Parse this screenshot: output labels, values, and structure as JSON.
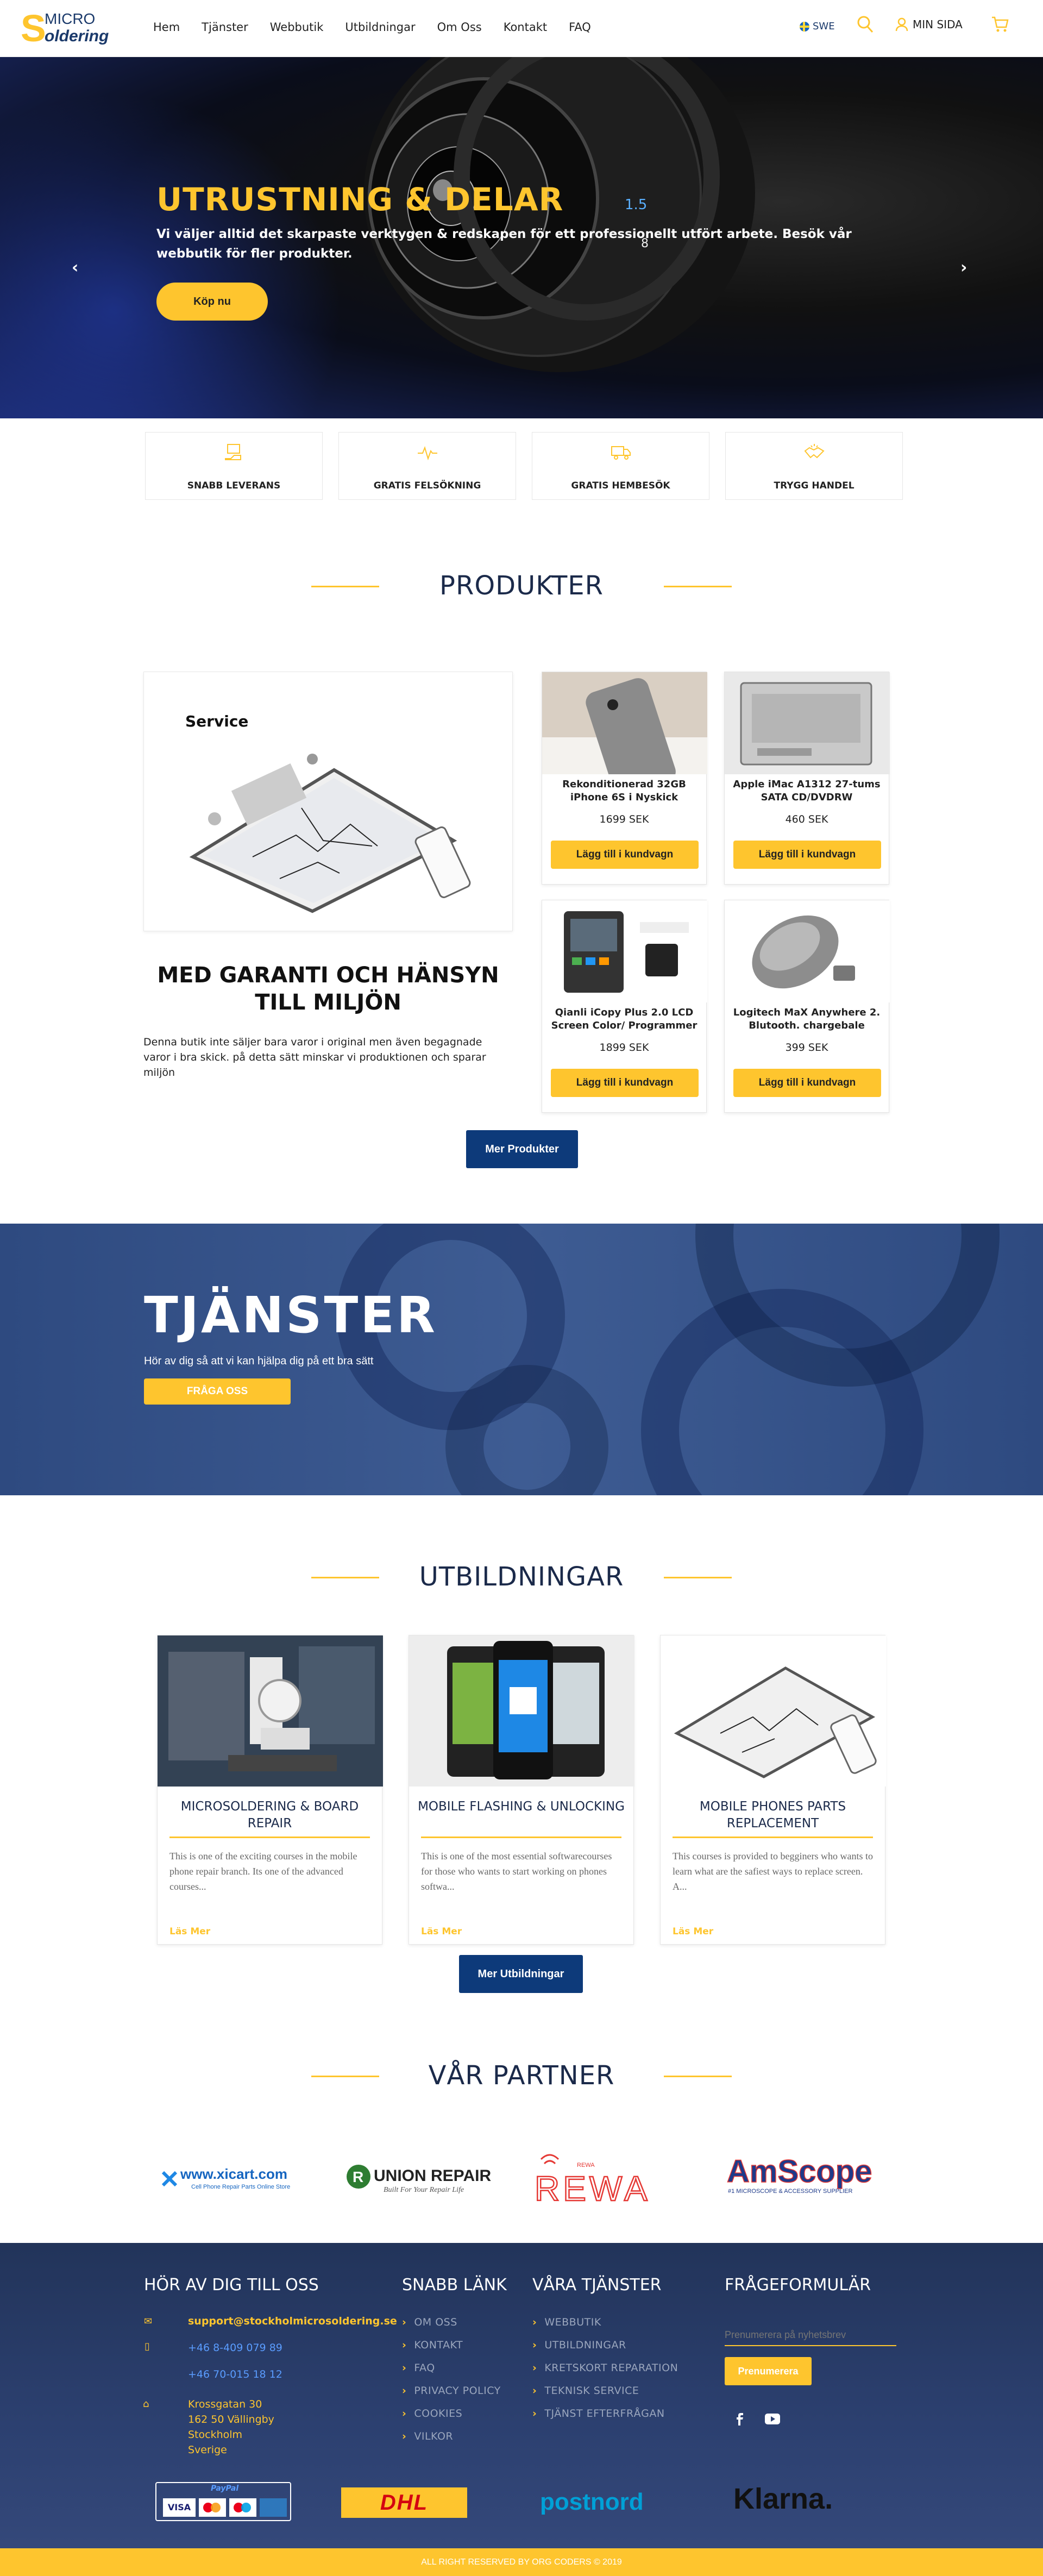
{
  "header": {
    "logo_top": "MICRO",
    "logo_bottom": "oldering",
    "logo_s": "S",
    "nav": [
      "Hem",
      "Tjänster",
      "Webbutik",
      "Utbildningar",
      "Om Oss",
      "Kontakt",
      "FAQ"
    ],
    "lang": "SWE",
    "account": "MIN SIDA"
  },
  "hero": {
    "title": "UTRUSTNING & DELAR",
    "text": "Vi väljer alltid det skarpaste verktygen & redskapen för ett professionellt utfört arbete. Besök vår webbutik för fler produkter.",
    "button": "Köp nu",
    "prev": "‹",
    "next": "›"
  },
  "features": [
    "SNABB LEVERANS",
    "GRATIS FELSÖKNING",
    "GRATIS HEMBESÖK",
    "TRYGG HANDEL"
  ],
  "products": {
    "heading": "PRODUKTER",
    "service_label": "Service",
    "items": [
      {
        "name": "Rekonditionerad 32GB iPhone 6S i Nyskick",
        "price": "1699 SEK",
        "button": "Lägg till i kundvagn"
      },
      {
        "name": "Apple iMac A1312 27-tums SATA CD/DVDRW",
        "price": "460 SEK",
        "button": "Lägg till i kundvagn"
      },
      {
        "name": "Qianli iCopy Plus 2.0 LCD Screen Color/ Programmer",
        "price": "1899 SEK",
        "button": "Lägg till i kundvagn"
      },
      {
        "name": "Logitech MaX Anywhere 2. Blutooth. chargebale",
        "price": "399 SEK",
        "button": "Lägg till i kundvagn"
      }
    ],
    "guarantee_title": "MED GARANTI OCH HÄNSYN TILL MILJÖN",
    "guarantee_text": "Denna butik inte säljer bara varor i original men även begagnade varor i bra skick. på detta sätt minskar vi produktionen och sparar miljön",
    "more_button": "Mer Produkter"
  },
  "services": {
    "title": "TJÄNSTER",
    "text": "Hör av dig så att vi kan hjälpa dig på ett bra sätt",
    "button": "FRÅGA OSS"
  },
  "courses": {
    "heading": "UTBILDNINGAR",
    "items": [
      {
        "title": "MICROSOLDERING & BOARD REPAIR",
        "text": "This is one of the exciting courses in the mobile phone repair branch. Its one of the advanced courses...",
        "more": "Läs Mer"
      },
      {
        "title": "MOBILE FLASHING & UNLOCKING",
        "text": "This is one of the most essential softwarecourses for those who wants to start working on phones softwa...",
        "more": "Läs Mer"
      },
      {
        "title": "MOBILE PHONES PARTS REPLACEMENT",
        "text": "This courses is provided to begginers who wants to learn what are the safiest ways to replace screen. A...",
        "more": "Läs Mer"
      }
    ],
    "more_button": "Mer Utbildningar"
  },
  "partners": {
    "heading": "VÅR PARTNER",
    "xicart": "www.xicart.com",
    "xicart_sub": "Cell Phone Repair Parts Online Store",
    "union": "UNION REPAIR",
    "union_sub": "Built For Your Repair Life",
    "rewa": "REWA",
    "amscope": "AmScope",
    "amscope_sub": "#1 MICROSCOPE & ACCESSORY SUPPLIER"
  },
  "footer": {
    "contact_heading": "HÖR AV DIG TILL OSS",
    "email": "support@stockholmicrosoldering.se",
    "phone1": "+46 8-409 079 89",
    "phone2": "+46 70-015 18 12",
    "address": [
      "Krossgatan 30",
      "162 50 Vällingby",
      "Stockholm",
      "Sverige"
    ],
    "links_heading": "SNABB LÄNK",
    "links": [
      "OM OSS",
      "KONTAKT",
      "FAQ",
      "PRIVACY POLICY",
      "COOKIES",
      "VILKOR"
    ],
    "services_heading": "VÅRA TJÄNSTER",
    "services": [
      "WEBBUTIK",
      "UTBILDNINGAR",
      "KRETSKORT REPARATION",
      "TEKNISK SERVICE",
      "TJÄNST EFTERFRÅGAN"
    ],
    "form_heading": "FRÅGEFORMULÄR",
    "newsletter_placeholder": "Prenumerera på nyhetsbrev",
    "subscribe": "Prenumerera",
    "paypal": "PayPal",
    "dhl": "DHL",
    "postnord": "postnord",
    "klarna": "Klarna."
  },
  "copyright": "ALL RIGHT RESERVED BY ORG CODERS © 2019",
  "colors": {
    "accent": "#fec52e",
    "navy": "#0d3a7a",
    "dark": "#1b2a4a"
  }
}
